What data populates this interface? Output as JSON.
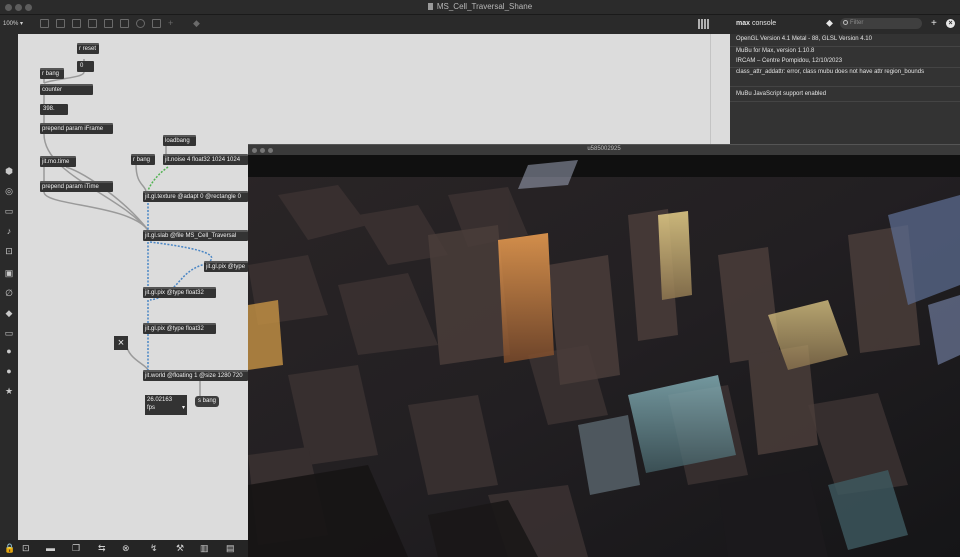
{
  "window": {
    "title": "MS_Cell_Traversal_Shane"
  },
  "toolbar": {
    "zoom": "100%"
  },
  "patch": {
    "objects": {
      "r_reset": "r reset",
      "num_zero": "0",
      "r_bang_top": "r bang",
      "counter": "counter",
      "num_398": "398.",
      "prepend_iframe": "prepend param iFrame",
      "loadbang": "loadbang",
      "jit_mo_time": "jit.mo.time",
      "r_bang": "r bang",
      "jit_noise": "jit.noise 4 float32 1024 1024",
      "prepend_itime": "prepend param iTime",
      "jit_gl_texture": "jit.gl.texture @adapt 0 @rectangle 0",
      "jit_gl_slab": "jit.gl.slab @file MS_Cell_Traversal",
      "jit_gl_pix_a": "jit.gl.pix @type float32",
      "jit_gl_pix_b": "jit.gl.pix @type float32",
      "jit_gl_pix_right": "jit.gl.pix @type",
      "jit_world": "jit.world @floating 1 @size 1280 720",
      "s_bang": "s bang"
    },
    "fps": {
      "value": "26.02163",
      "unit": "fps"
    }
  },
  "console": {
    "title_bold": "max",
    "title_rest": " console",
    "filter_placeholder": "Filter",
    "lines": [
      "OpenGL Version 4.1 Metal - 88, GLSL Version 4.10",
      "MuBu for Max, version 1.10.8",
      "   IRCAM – Centre Pompidou, 12/10/2023",
      "class_attr_addattr: error, class mubu does not have attr region_bounds",
      "MuBu JavaScript support enabled"
    ]
  },
  "render_window": {
    "title": "u585002925"
  },
  "icons": {
    "toolbar": [
      "lock-icon",
      "presentation-icon",
      "new-object-icon",
      "message-icon",
      "toggle-icon",
      "button-icon",
      "comment-icon",
      "slider-icon",
      "dial-icon",
      "add-icon",
      "paint-icon",
      "grid-icon"
    ],
    "left": [
      "cube-icon",
      "target-icon",
      "object-icon",
      "note-icon",
      "inspector-icon",
      "image-icon",
      "clip-icon",
      "snippet-icon",
      "debug-icon",
      "info-icon",
      "help-icon",
      "star-icon"
    ],
    "bottom": [
      "lock-icon",
      "presentation-icon",
      "comment-icon",
      "layers-icon",
      "link-icon",
      "cord-icon",
      "wrench-icon",
      "piano-icon",
      "keyboard-icon"
    ]
  },
  "colors": {
    "canvas": "#dcdcdc",
    "object": "#333333",
    "console_bg": "#333333",
    "signal_cord": "#52b352",
    "jitter_cord": "#4a86c5"
  }
}
